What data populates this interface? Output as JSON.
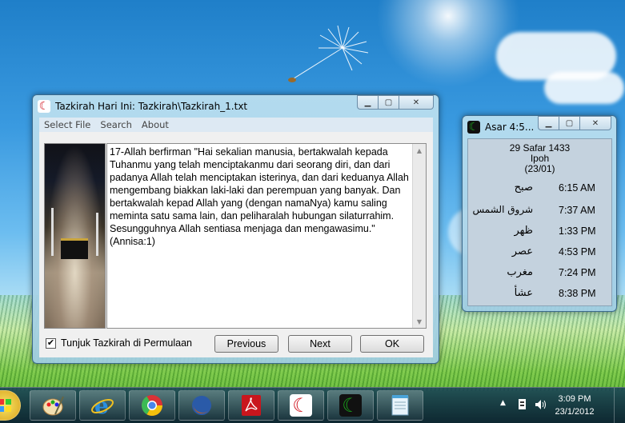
{
  "desktop": {},
  "tazkirah_window": {
    "title": "Tazkirah Hari Ini: Tazkirah\\Tazkirah_1.txt",
    "menu": [
      "Select File",
      "Search",
      "About"
    ],
    "text": "17-Allah berfirman \"Hai sekalian manusia, bertakwalah kepada Tuhanmu yang telah menciptakanmu dari seorang diri, dan dari padanya Allah telah menciptakan isterinya, dan dari keduanya Allah mengembang biakkan laki-laki dan perempuan yang banyak. Dan bertakwalah kepad Allah yang (dengan namaNya) kamu saling meminta satu sama lain, dan peliharalah hubungan silaturrahim. Sesungguhnya Allah sentiasa menjaga dan mengawasimu.\"(Annisa:1)",
    "checkbox_label": "Tunjuk Tazkirah di Permulaan",
    "checkbox_checked": true,
    "checkbox_mark": "✔",
    "buttons": {
      "previous": "Previous",
      "next": "Next",
      "ok": "OK"
    }
  },
  "prayer_window": {
    "title": "Asar 4:5...",
    "hijri_date": "29 Safar 1433",
    "location": "Ipoh",
    "zone": "(23/01)",
    "times": [
      {
        "name": "صبح",
        "time": "6:15 AM"
      },
      {
        "name": "شروق الشمس",
        "time": "7:37 AM"
      },
      {
        "name": "ظهر",
        "time": "1:33 PM"
      },
      {
        "name": "عصر",
        "time": "4:53 PM"
      },
      {
        "name": "مغرب",
        "time": "7:24 PM"
      },
      {
        "name": "عشأ",
        "time": "8:38 PM"
      }
    ]
  },
  "window_controls": {
    "minimize": "▁",
    "maximize": "▢",
    "close": "✕"
  },
  "taskbar": {
    "time": "3:09 PM",
    "date": "23/1/2012",
    "apps": [
      "start-orb",
      "paint-icon",
      "ie-icon",
      "chrome-icon",
      "firefox-icon",
      "acrobat-icon",
      "tazkirah-app-icon",
      "waktu-solat-app-icon",
      "notepad-icon"
    ]
  },
  "colors": {
    "tazkirah_accent": "#d0101a",
    "prayer_accent": "#1aa11a"
  }
}
